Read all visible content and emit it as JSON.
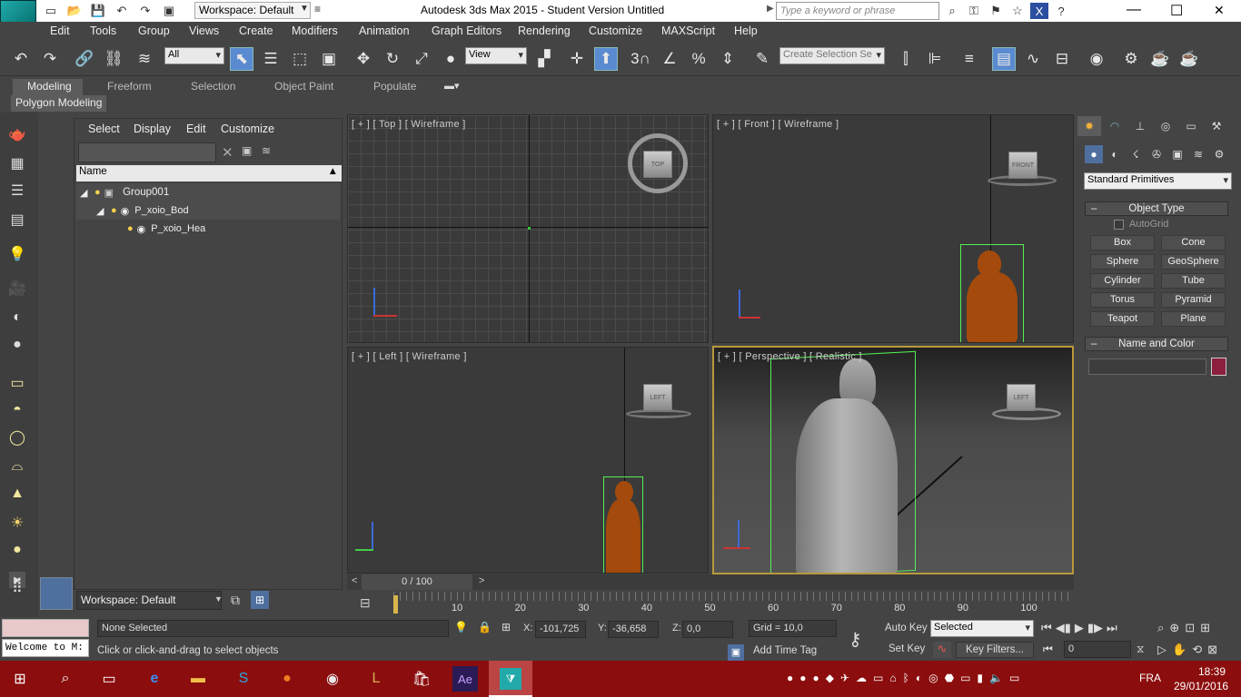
{
  "title_bar": {
    "app_logo": "MAX",
    "workspace": "Workspace: Default",
    "title": "Autodesk 3ds Max  2015   - Student Version   Untitled",
    "search_placeholder": "Type a keyword or phrase",
    "min": "—",
    "max": "☐",
    "close": "✕"
  },
  "menu": [
    "Edit",
    "Tools",
    "Group",
    "Views",
    "Create",
    "Modifiers",
    "Animation",
    "Graph Editors",
    "Rendering",
    "Customize",
    "MAXScript",
    "Help"
  ],
  "main_toolbar": {
    "filter_select": "All",
    "ref_coord": "View",
    "snap_label": "3",
    "selection_set": "Create Selection Se"
  },
  "ribbon": {
    "tabs": [
      "Modeling",
      "Freeform",
      "Selection",
      "Object Paint",
      "Populate"
    ],
    "active_tab": "Modeling",
    "sub_label": "Polygon Modeling"
  },
  "scene_explorer": {
    "menu": [
      "Select",
      "Display",
      "Edit",
      "Customize"
    ],
    "column_header": "Name",
    "items": [
      {
        "name": "Group001",
        "level": 0
      },
      {
        "name": "P_xoio_Bod",
        "level": 1
      },
      {
        "name": "P_xoio_Hea",
        "level": 2
      }
    ],
    "workspace": "Workspace: Default"
  },
  "viewports": {
    "top": {
      "label": "[ + ] [ Top ] [ Wireframe ]",
      "cube": "TOP"
    },
    "front": {
      "label": "[ + ] [ Front ] [ Wireframe ]",
      "cube": "FRONT"
    },
    "left": {
      "label": "[ + ] [ Left ] [ Wireframe ]",
      "cube": "LEFT"
    },
    "perspective": {
      "label": "[ + ] [ Perspective ] [ Realistic ]",
      "cube": "LEFT"
    }
  },
  "command_panel": {
    "category": "Standard Primitives",
    "object_type_title": "Object Type",
    "autogrid": "AutoGrid",
    "buttons": [
      "Box",
      "Cone",
      "Sphere",
      "GeoSphere",
      "Cylinder",
      "Tube",
      "Torus",
      "Pyramid",
      "Teapot",
      "Plane"
    ],
    "name_color_title": "Name and Color",
    "object_color": "#8b1f3d"
  },
  "timeline": {
    "frame": "0 / 100",
    "ticks": [
      "10",
      "20",
      "30",
      "40",
      "50",
      "60",
      "70",
      "80",
      "90",
      "100"
    ]
  },
  "status": {
    "maxscript_text": "Welcome to M:",
    "selection": "None Selected",
    "prompt": "Click or click-and-drag to select objects",
    "x_label": "X:",
    "x_value": "-101,725",
    "y_label": "Y:",
    "y_value": "-36,658",
    "z_label": "Z:",
    "z_value": "0,0",
    "grid": "Grid = 10,0",
    "add_time_tag": "Add Time Tag",
    "auto_key": "Auto Key",
    "set_key": "Set Key",
    "key_mode": "Selected",
    "key_filters": "Key Filters...",
    "current_frame": "0"
  },
  "taskbar": {
    "lang": "FRA",
    "time": "18:39",
    "date": "29/01/2016",
    "apps": [
      "Start",
      "Search",
      "Task View",
      "Edge",
      "Explorer",
      "Skype",
      "Firefox",
      "Chrome",
      "League",
      "Store",
      "After Effects",
      "3ds Max"
    ]
  }
}
